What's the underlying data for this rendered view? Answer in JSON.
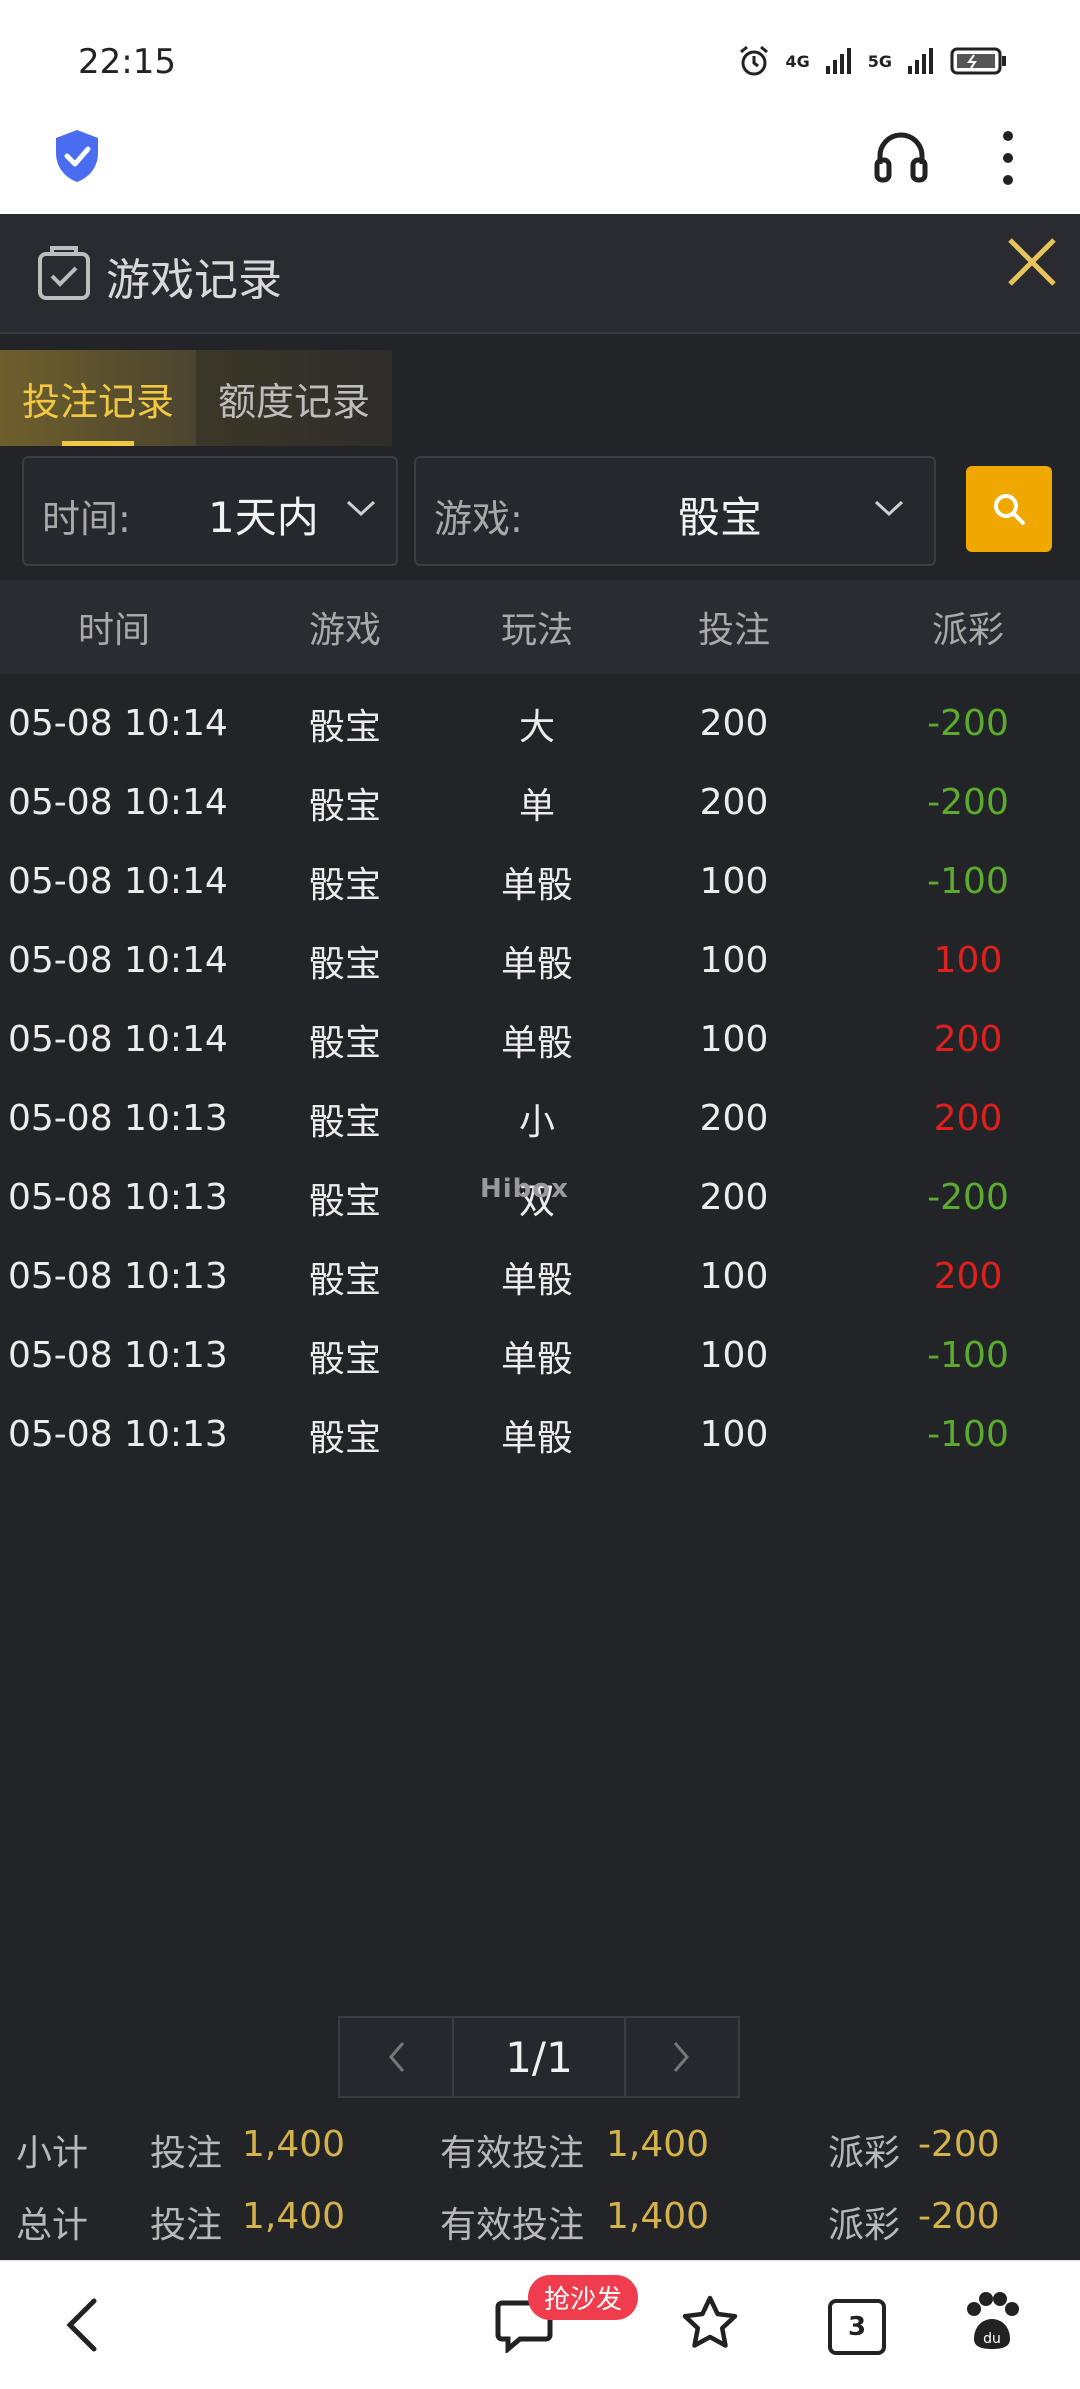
{
  "status": {
    "time": "22:15",
    "net1": "4G",
    "net2": "5G"
  },
  "app": {
    "title": "游戏记录",
    "tabs": [
      {
        "label": "投注记录",
        "active": true
      },
      {
        "label": "额度记录",
        "active": false
      }
    ],
    "filters": {
      "time_label": "时间:",
      "time_value": "1天内",
      "game_label": "游戏:",
      "game_value": "骰宝"
    },
    "table": {
      "headers": [
        "时间",
        "游戏",
        "玩法",
        "投注",
        "派彩"
      ],
      "rows": [
        [
          "05-08 10:14",
          "骰宝",
          "大",
          "200",
          "-200"
        ],
        [
          "05-08 10:14",
          "骰宝",
          "单",
          "200",
          "-200"
        ],
        [
          "05-08 10:14",
          "骰宝",
          "单骰",
          "100",
          "-100"
        ],
        [
          "05-08 10:14",
          "骰宝",
          "单骰",
          "100",
          "100"
        ],
        [
          "05-08 10:14",
          "骰宝",
          "单骰",
          "100",
          "200"
        ],
        [
          "05-08 10:13",
          "骰宝",
          "小",
          "200",
          "200"
        ],
        [
          "05-08 10:13",
          "骰宝",
          "双",
          "200",
          "-200"
        ],
        [
          "05-08 10:13",
          "骰宝",
          "单骰",
          "100",
          "200"
        ],
        [
          "05-08 10:13",
          "骰宝",
          "单骰",
          "100",
          "-100"
        ],
        [
          "05-08 10:13",
          "骰宝",
          "单骰",
          "100",
          "-100"
        ]
      ]
    },
    "watermark": "Hibox",
    "pager": {
      "prev": "‹",
      "page": "1/1",
      "next": "›"
    },
    "summary": [
      {
        "name": "小计",
        "bet_label": "投注",
        "bet": "1,400",
        "valid_label": "有效投注",
        "valid": "1,400",
        "payout_label": "派彩",
        "payout": "-200"
      },
      {
        "name": "总计",
        "bet_label": "投注",
        "bet": "1,400",
        "valid_label": "有效投注",
        "valid": "1,400",
        "payout_label": "派彩",
        "payout": "-200"
      }
    ]
  },
  "browser_nav": {
    "comment_badge": "抢沙发",
    "tab_count": "3"
  },
  "colors": {
    "accent": "#f0a800",
    "negative": "#5aab2e",
    "positive": "#e0201c",
    "gold_text": "#d4b24c",
    "panel": "#232428"
  }
}
